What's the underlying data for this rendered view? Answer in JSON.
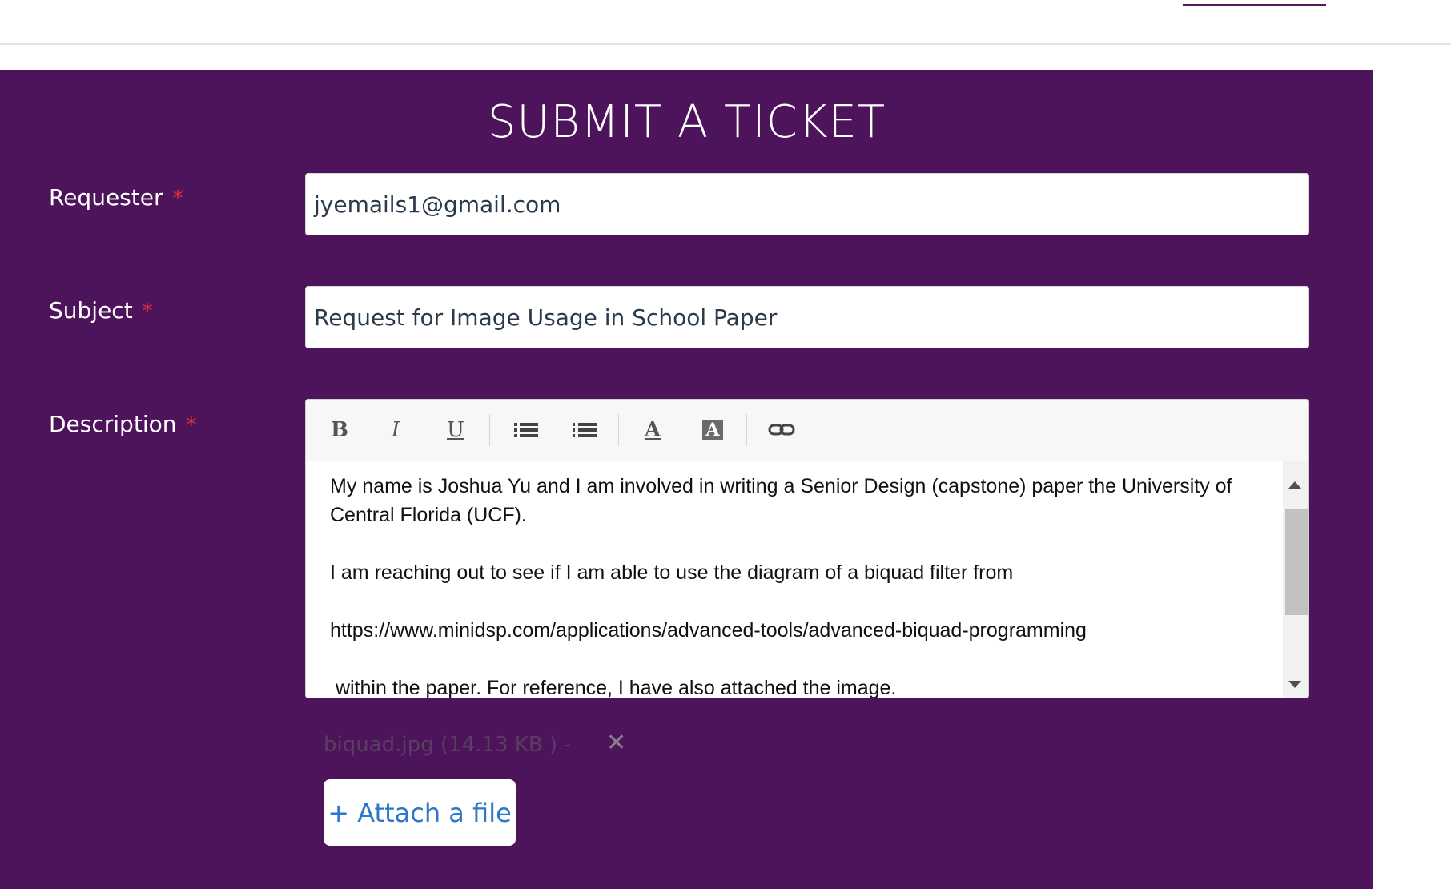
{
  "page": {
    "title": "SUBMIT A TICKET"
  },
  "form": {
    "requester": {
      "label": "Requester",
      "required_mark": "*",
      "value": "jyemails1@gmail.com"
    },
    "subject": {
      "label": "Subject",
      "required_mark": "*",
      "value": "Request for Image Usage in School Paper"
    },
    "description": {
      "label": "Description",
      "required_mark": "*",
      "toolbar": {
        "bold": "B",
        "italic": "I",
        "underline": "U",
        "text_color": "A",
        "background_color": "A"
      },
      "paragraphs": [
        "My name is Joshua Yu and I am involved in writing a Senior Design (capstone) paper the University of Central Florida (UCF).",
        "",
        "I am reaching out to see if I am able to use the diagram of a biquad filter from",
        "",
        "https://www.minidsp.com/applications/advanced-tools/advanced-biquad-programming",
        "",
        " within the paper. For reference, I have also attached the image."
      ]
    },
    "attachment": {
      "text": "biquad.jpg (14.13 KB ) -",
      "remove_glyph": "✕"
    },
    "attach_button": "+ Attach a file"
  },
  "colors": {
    "panel_bg": "#4e145b",
    "required_star": "#e5322d",
    "attach_link": "#2b78c9"
  },
  "icons": [
    "bold-icon",
    "italic-icon",
    "underline-icon",
    "bullet-list-icon",
    "numbered-list-icon",
    "text-color-icon",
    "background-color-icon",
    "link-icon",
    "close-icon"
  ]
}
